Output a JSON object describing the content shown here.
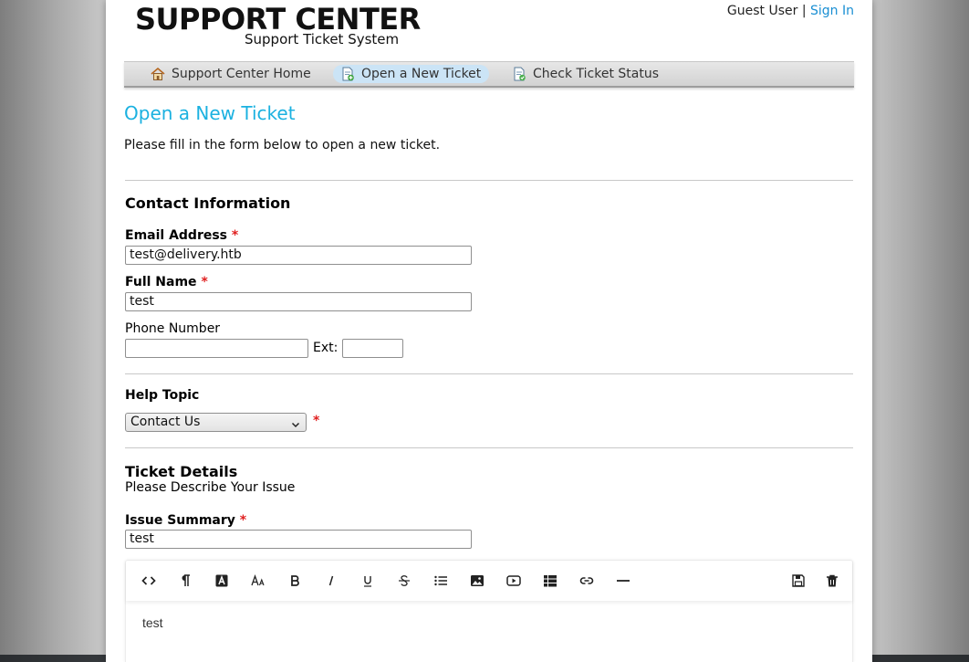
{
  "header": {
    "logo_title": "SUPPORT CENTER",
    "logo_subtitle": "Support Ticket System",
    "guest_text": "Guest User |",
    "sign_in_label": "Sign In"
  },
  "nav": {
    "items": [
      {
        "label": "Support Center Home",
        "icon": "home-icon",
        "active": false
      },
      {
        "label": "Open a New Ticket",
        "icon": "new-ticket-icon",
        "active": true
      },
      {
        "label": "Check Ticket Status",
        "icon": "ticket-status-icon",
        "active": false
      }
    ]
  },
  "page": {
    "title": "Open a New Ticket",
    "intro": "Please fill in the form below to open a new ticket."
  },
  "contact": {
    "heading": "Contact Information",
    "email_label": "Email Address",
    "email_value": "test@delivery.htb",
    "name_label": "Full Name",
    "name_value": "test",
    "phone_label": "Phone Number",
    "phone_value": "",
    "ext_label": "Ext:",
    "ext_value": ""
  },
  "help_topic": {
    "label": "Help Topic",
    "selected": "Contact Us"
  },
  "required_marker": "*",
  "ticket": {
    "heading": "Ticket Details",
    "subheading": "Please Describe Your Issue",
    "summary_label": "Issue Summary",
    "summary_value": "test",
    "body_text": "test"
  },
  "editor_toolbar": [
    "code-view-icon",
    "paragraph-icon",
    "text-color-icon",
    "font-size-icon",
    "bold-icon",
    "italic-icon",
    "underline-icon",
    "strikethrough-icon",
    "bullet-list-icon",
    "image-icon",
    "video-icon",
    "table-icon",
    "link-icon",
    "horizontal-rule-icon",
    "save-draft-icon",
    "delete-draft-icon"
  ],
  "colors": {
    "accent": "#1bb1e0",
    "link": "#1a8fd3",
    "required": "#e02020",
    "nav_active": "#cbe4f6"
  }
}
